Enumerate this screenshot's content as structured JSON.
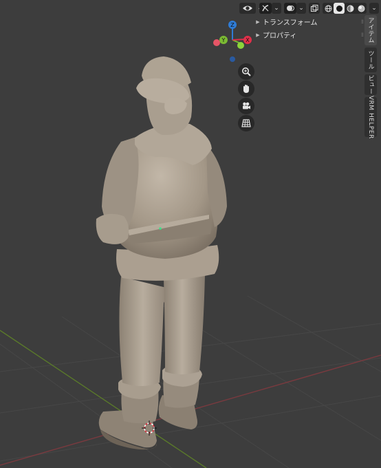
{
  "toolbar": {
    "view_object_types_icon": "eye-icon",
    "gizmo_icon": "gizmo-icon",
    "overlays_icon": "overlays-icon",
    "xray_icon": "xray-icon",
    "shading_modes": [
      "wireframe",
      "solid",
      "material-preview",
      "rendered"
    ],
    "active_shading": "solid"
  },
  "panel": {
    "sections": [
      {
        "label": "トランスフォーム"
      },
      {
        "label": "プロパティ"
      }
    ]
  },
  "tabs": [
    {
      "label": "アイテム",
      "active": true
    },
    {
      "label": "ツール",
      "active": false
    },
    {
      "label": "ビュー",
      "active": false
    },
    {
      "label": "VRM HELPER",
      "active": false
    }
  ],
  "gizmo": {
    "axes": [
      {
        "label": "Z",
        "color": "#2f7cd6"
      },
      {
        "label": "Y",
        "color": "#7bbb33"
      },
      {
        "label": "X",
        "color": "#e0304a"
      }
    ]
  },
  "nav_buttons": [
    "zoom-icon",
    "pan-hand-icon",
    "camera-icon",
    "ortho-grid-icon"
  ],
  "colors": {
    "viewport_bg": "#3d3d3d",
    "grid_line": "#474747",
    "axis_x_line": "#7a3a3f",
    "axis_y_line": "#5a7a2a",
    "model": "#a59a8c"
  }
}
